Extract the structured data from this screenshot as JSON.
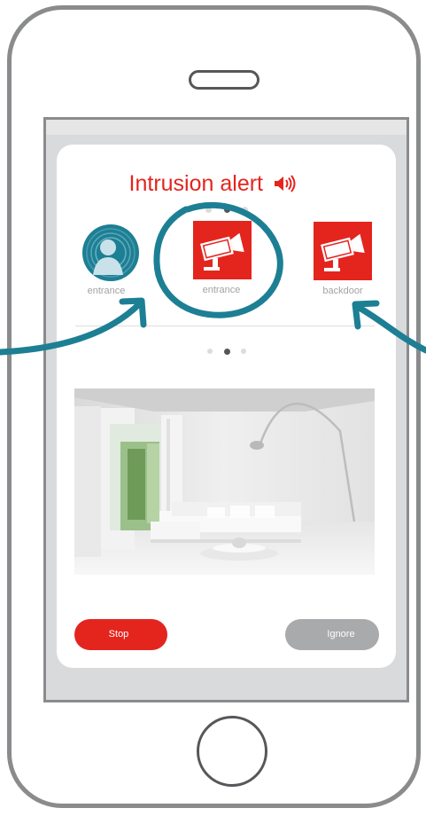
{
  "alert": {
    "title": "Intrusion alert",
    "icon": "alarm-speaker-icon",
    "accent_color": "#e3251e"
  },
  "carousel": {
    "top_dots": {
      "count": 3,
      "active_index": 1
    },
    "bottom_dots": {
      "count": 3,
      "active_index": 1
    }
  },
  "cameras": [
    {
      "label": "entrance",
      "icon": "user-avatar-icon",
      "selected": false
    },
    {
      "label": "entrance",
      "icon": "security-camera-icon",
      "selected": true
    },
    {
      "label": "backdoor",
      "icon": "security-camera-icon",
      "selected": false
    }
  ],
  "feed": {
    "image": "living-room-camera-feed"
  },
  "actions": {
    "stop_label": "Stop",
    "ignore_label": "Ignore"
  },
  "colors": {
    "primary_red": "#e3251e",
    "annotation_teal": "#1d7f94",
    "button_gray": "#a9aaac",
    "frame_gray": "#8a8b8d"
  }
}
